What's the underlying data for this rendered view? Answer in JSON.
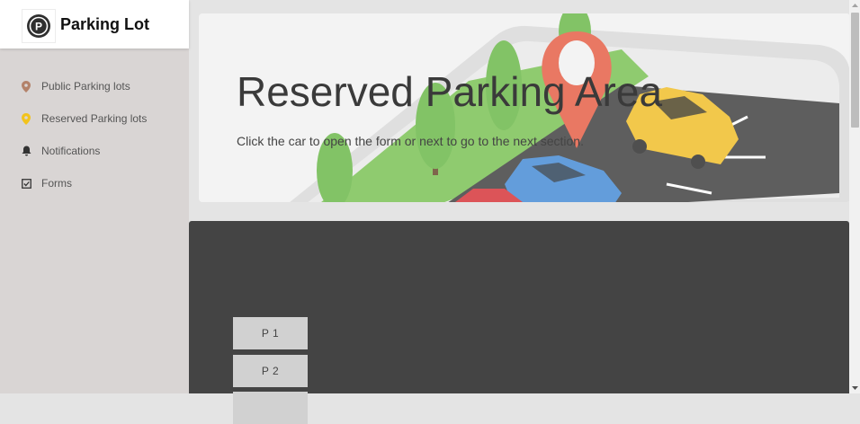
{
  "brand": {
    "title": "Parking Lot",
    "logo_letter": "P"
  },
  "sidebar": {
    "items": [
      {
        "label": "Public Parking lots",
        "icon": "map-pin-icon",
        "color": "#b3826a"
      },
      {
        "label": "Reserved Parking lots",
        "icon": "map-pin-icon",
        "color": "#f2c31c"
      },
      {
        "label": "Notifications",
        "icon": "bell-icon",
        "color": "#333333"
      },
      {
        "label": "Forms",
        "icon": "checkbox-icon",
        "color": "#333333"
      }
    ]
  },
  "hero": {
    "title": "Reserved Parking Area",
    "subtitle": "Click the car to open the form or next to go to the next section."
  },
  "lot": {
    "slots": [
      "P 1",
      "P 2"
    ]
  },
  "colors": {
    "sidebar_bg": "#d9d5d4",
    "lot_bg": "#444444",
    "slot_bg": "#d1d1d1",
    "pin_red": "#e8634a",
    "car_yellow": "#f2c12e",
    "car_blue": "#4b8fd8",
    "car_red": "#d9393e",
    "tree_green": "#6fbb4e"
  }
}
